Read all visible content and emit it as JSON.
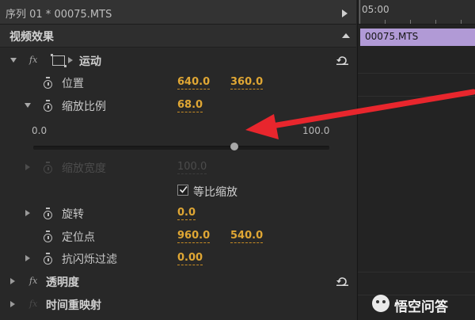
{
  "sequence": {
    "title": "序列 01 * 00075.MTS"
  },
  "panel": {
    "title": "视频效果"
  },
  "effects": {
    "motion": {
      "label": "运动",
      "position": {
        "label": "位置",
        "x": "640.0",
        "y": "360.0"
      },
      "scale": {
        "label": "缩放比例",
        "value": "68.0",
        "slider_min": "0.0",
        "slider_max": "100.0",
        "slider_fraction": 0.68
      },
      "scale_width": {
        "label": "缩放宽度",
        "value": "100.0"
      },
      "uniform_scale": {
        "label": "等比缩放",
        "checked": true
      },
      "rotation": {
        "label": "旋转",
        "value": "0.0"
      },
      "anchor": {
        "label": "定位点",
        "x": "960.0",
        "y": "540.0"
      },
      "flicker": {
        "label": "抗闪烁过滤",
        "value": "0.00"
      }
    },
    "opacity": {
      "label": "透明度"
    },
    "time_remap": {
      "label": "时间重映射"
    }
  },
  "timeline": {
    "time": "05:00",
    "clip": "00075.MTS"
  },
  "watermark": {
    "text": "悟空问答"
  },
  "colors": {
    "value": "#e0a734",
    "clip": "#b19ad6",
    "arrow": "#e8262d"
  }
}
